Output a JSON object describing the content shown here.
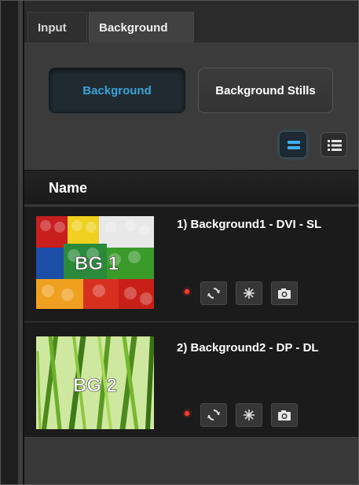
{
  "tabs": [
    {
      "label": "Input",
      "active": false
    },
    {
      "label": "Background",
      "active": true
    }
  ],
  "segment": {
    "background_label": "Background",
    "stills_label": "Background Stills",
    "active": "Background"
  },
  "view_toggle": {
    "grid_icon": "grid-view-icon",
    "list_icon": "list-view-icon",
    "active": "grid"
  },
  "list": {
    "header": "Name",
    "rows": [
      {
        "title": "1) Background1 - DVI - SL",
        "thumb_label": "BG 1",
        "status_color": "#ff3b30",
        "icons": [
          "refresh-icon",
          "freeze-icon",
          "camera-icon"
        ]
      },
      {
        "title": "2) Background2 - DP - DL",
        "thumb_label": "BG 2",
        "status_color": "#ff3b30",
        "icons": [
          "refresh-icon",
          "freeze-icon",
          "camera-icon"
        ]
      }
    ]
  },
  "colors": {
    "accent": "#3ba4d8",
    "status_dot": "#ff3b30"
  }
}
